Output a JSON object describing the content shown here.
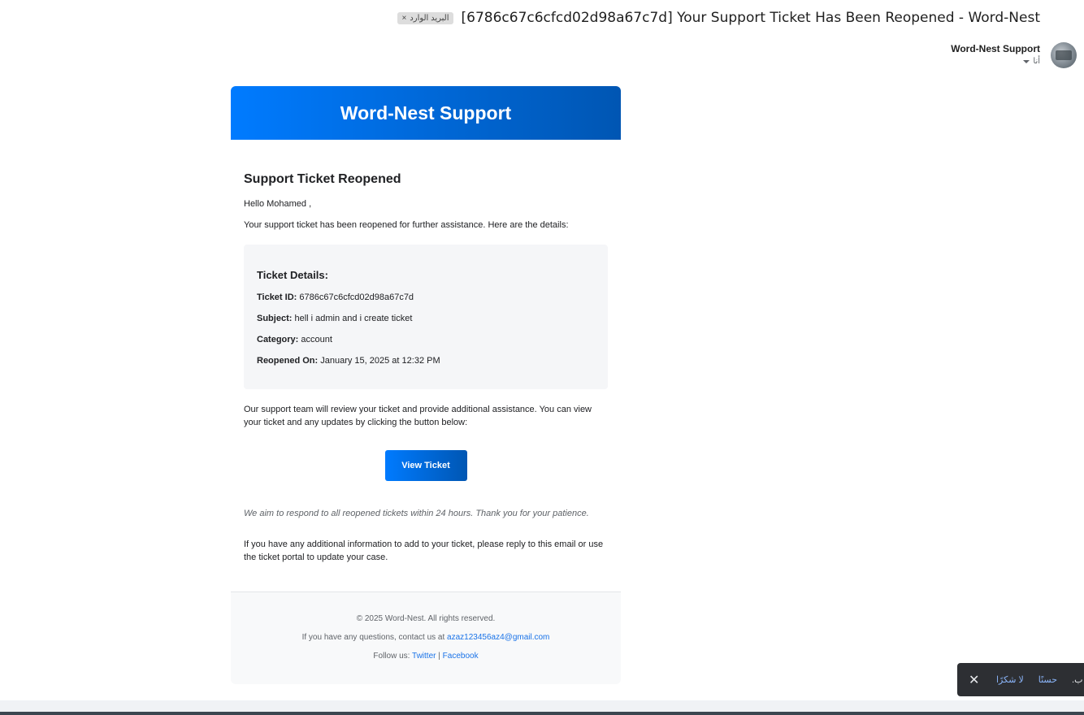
{
  "email": {
    "subject": "[6786c67c6cfcd02d98a67c7d] Your Support Ticket Has Been Reopened - Word-Nest",
    "label": "البريد الوارد",
    "label_close": "×",
    "sender_name": "Word-Nest Support",
    "recipient": "أنا"
  },
  "message": {
    "header_title": "Word-Nest Support",
    "title": "Support Ticket Reopened",
    "greeting": "Hello Mohamed ,",
    "intro": "Your support ticket has been reopened for further assistance. Here are the details:",
    "details": {
      "title": "Ticket Details:",
      "rows": [
        {
          "label": "Ticket ID:",
          "value": "6786c67c6cfcd02d98a67c7d"
        },
        {
          "label": "Subject:",
          "value": "hell i admin and i create ticket"
        },
        {
          "label": "Category:",
          "value": "account"
        },
        {
          "label": "Reopened On:",
          "value": "January 15, 2025 at 12:32 PM"
        }
      ]
    },
    "review_text": "Our support team will review your ticket and provide additional assistance. You can view your ticket and any updates by clicking the button below:",
    "button_label": "View Ticket",
    "aim_text": "We aim to respond to all reopened tickets within 24 hours. Thank you for your patience.",
    "additional_text": "If you have any additional information to add to your ticket, please reply to this email or use the ticket portal to update your case.",
    "footer": {
      "copyright": "© 2025 Word-Nest. All rights reserved.",
      "contact_prefix": "If you have any questions, contact us at",
      "contact_email": "azaz123456az4@gmail.com",
      "follow_prefix": "Follow us:",
      "twitter": "Twitter",
      "separator": "|",
      "facebook": "Facebook"
    }
  },
  "snackbar": {
    "close": "✕",
    "decline": "لا شكرًا",
    "accept": "حسنًا",
    "message": "ب."
  },
  "colors": {
    "header_gradient_start": "#007bff",
    "header_gradient_end": "#0056b3",
    "link": "#1a73e8"
  }
}
